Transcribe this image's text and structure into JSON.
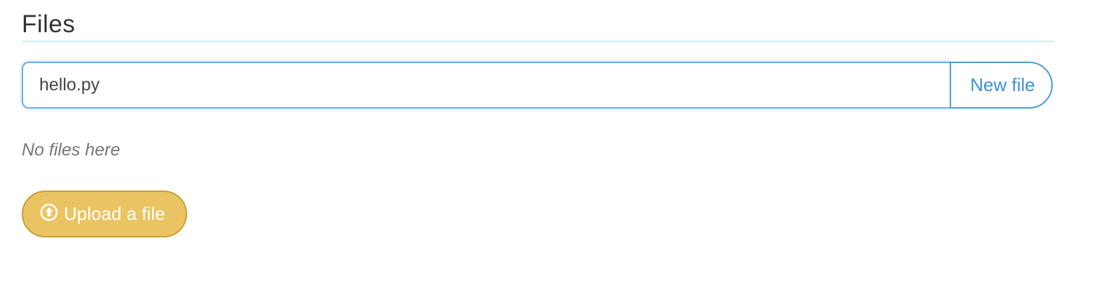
{
  "section": {
    "title": "Files"
  },
  "new_file": {
    "input_value": "hello.py",
    "button_label": "New file"
  },
  "file_list": {
    "empty_message": "No files here"
  },
  "upload": {
    "icon": "upload-circle-icon",
    "button_label": "Upload a file"
  },
  "colors": {
    "accent_blue": "#3c91d0",
    "focus_border": "#6aaeea",
    "upload_fill": "#eac462",
    "upload_border": "#c9a034",
    "title_rule": "#c9edf4"
  }
}
